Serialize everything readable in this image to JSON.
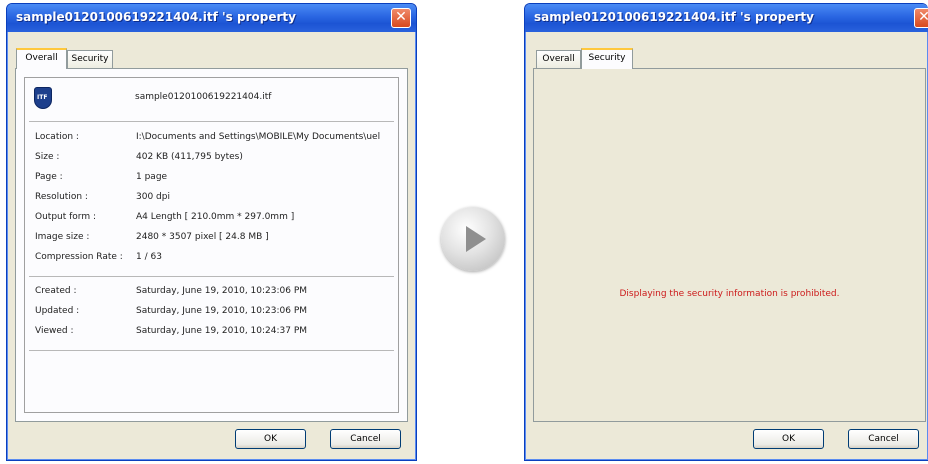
{
  "left_window": {
    "title": "sample0120100619221404.itf 's property",
    "close_glyph": "✕",
    "tabs": [
      "Overall",
      "Security"
    ],
    "active_tab": "Overall",
    "icon_text": "ITF",
    "file_name": "sample0120100619221404.itf",
    "properties": [
      {
        "label": "Location :",
        "value": "I:\\Documents and Settings\\MOBILE\\My Documents\\uel"
      },
      {
        "label": "Size :",
        "value": "402 KB (411,795 bytes)"
      },
      {
        "label": "Page :",
        "value": "1 page"
      },
      {
        "label": "Resolution :",
        "value": "300 dpi"
      },
      {
        "label": "Output form :",
        "value": "A4 Length [ 210.0mm * 297.0mm ]"
      },
      {
        "label": "Image size :",
        "value": "2480 * 3507 pixel [ 24.8 MB ]"
      },
      {
        "label": "Compression Rate :",
        "value": "1 / 63"
      }
    ],
    "dates": [
      {
        "label": "Created :",
        "value": "Saturday, June 19, 2010, 10:23:06 PM"
      },
      {
        "label": "Updated :",
        "value": "Saturday, June 19, 2010, 10:23:06 PM"
      },
      {
        "label": "Viewed :",
        "value": "Saturday, June 19, 2010, 10:24:37 PM"
      }
    ],
    "ok_label": "OK",
    "cancel_label": "Cancel"
  },
  "right_window": {
    "title": "sample0120100619221404.itf 's property",
    "close_glyph": "✕",
    "tabs": [
      "Overall",
      "Security"
    ],
    "active_tab": "Security",
    "message": "Displaying the security information is prohibited.",
    "ok_label": "OK",
    "cancel_label": "Cancel"
  },
  "icons": {
    "play": "play-icon",
    "file": "itf-file-icon",
    "close": "close-icon"
  },
  "colors": {
    "title_bar": "#2a66e2",
    "dialog_bg": "#ece9d8",
    "message_text": "#cc1b1b",
    "active_tab_accent": "#ffc83c"
  }
}
